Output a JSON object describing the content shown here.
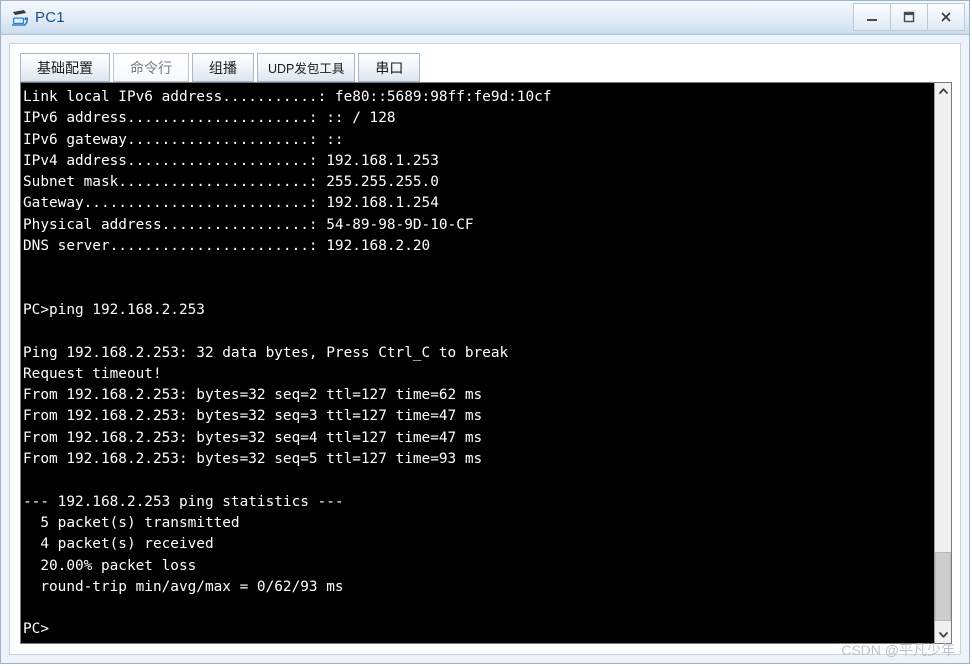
{
  "window": {
    "title": "PC1",
    "icon": "pc-device-icon",
    "controls": [
      {
        "name": "minimize-button",
        "label": "–",
        "icon": "minimize-icon"
      },
      {
        "name": "maximize-button",
        "label": "❐",
        "icon": "maximize-icon"
      },
      {
        "name": "close-button",
        "label": "X",
        "icon": "close-icon"
      }
    ],
    "frame_color": "#9db3cc",
    "titlebar_color": "#cfdff0",
    "title_text_color": "#1a4f8a"
  },
  "tabs": [
    {
      "label": "基础配置",
      "name": "tab-basic-config",
      "active": false,
      "small": false
    },
    {
      "label": "命令行",
      "name": "tab-command-line",
      "active": true,
      "small": false
    },
    {
      "label": "组播",
      "name": "tab-multicast",
      "active": false,
      "small": false
    },
    {
      "label": "UDP发包工具",
      "name": "tab-udp-tool",
      "active": false,
      "small": true
    },
    {
      "label": "串口",
      "name": "tab-serial-port",
      "active": false,
      "small": false
    }
  ],
  "terminal": {
    "background": "#000000",
    "foreground": "#ffffff",
    "lines": [
      "Link local IPv6 address...........: fe80::5689:98ff:fe9d:10cf",
      "IPv6 address.....................: :: / 128",
      "IPv6 gateway.....................: ::",
      "IPv4 address.....................: 192.168.1.253",
      "Subnet mask......................: 255.255.255.0",
      "Gateway..........................: 192.168.1.254",
      "Physical address.................: 54-89-98-9D-10-CF",
      "DNS server.......................: 192.168.2.20",
      "",
      "",
      "PC>ping 192.168.2.253",
      "",
      "Ping 192.168.2.253: 32 data bytes, Press Ctrl_C to break",
      "Request timeout!",
      "From 192.168.2.253: bytes=32 seq=2 ttl=127 time=62 ms",
      "From 192.168.2.253: bytes=32 seq=3 ttl=127 time=47 ms",
      "From 192.168.2.253: bytes=32 seq=4 ttl=127 time=47 ms",
      "From 192.168.2.253: bytes=32 seq=5 ttl=127 time=93 ms",
      "",
      "--- 192.168.2.253 ping statistics ---",
      "  5 packet(s) transmitted",
      "  4 packet(s) received",
      "  20.00% packet loss",
      "  round-trip min/avg/max = 0/62/93 ms",
      "",
      "PC>"
    ]
  },
  "scrollbar": {
    "up_arrow_icon": "chevron-up-icon",
    "down_arrow_icon": "chevron-down-icon",
    "thumb_top_percent": 86,
    "thumb_height_percent": 13
  },
  "watermark": {
    "text": "CSDN @平凡少年"
  }
}
